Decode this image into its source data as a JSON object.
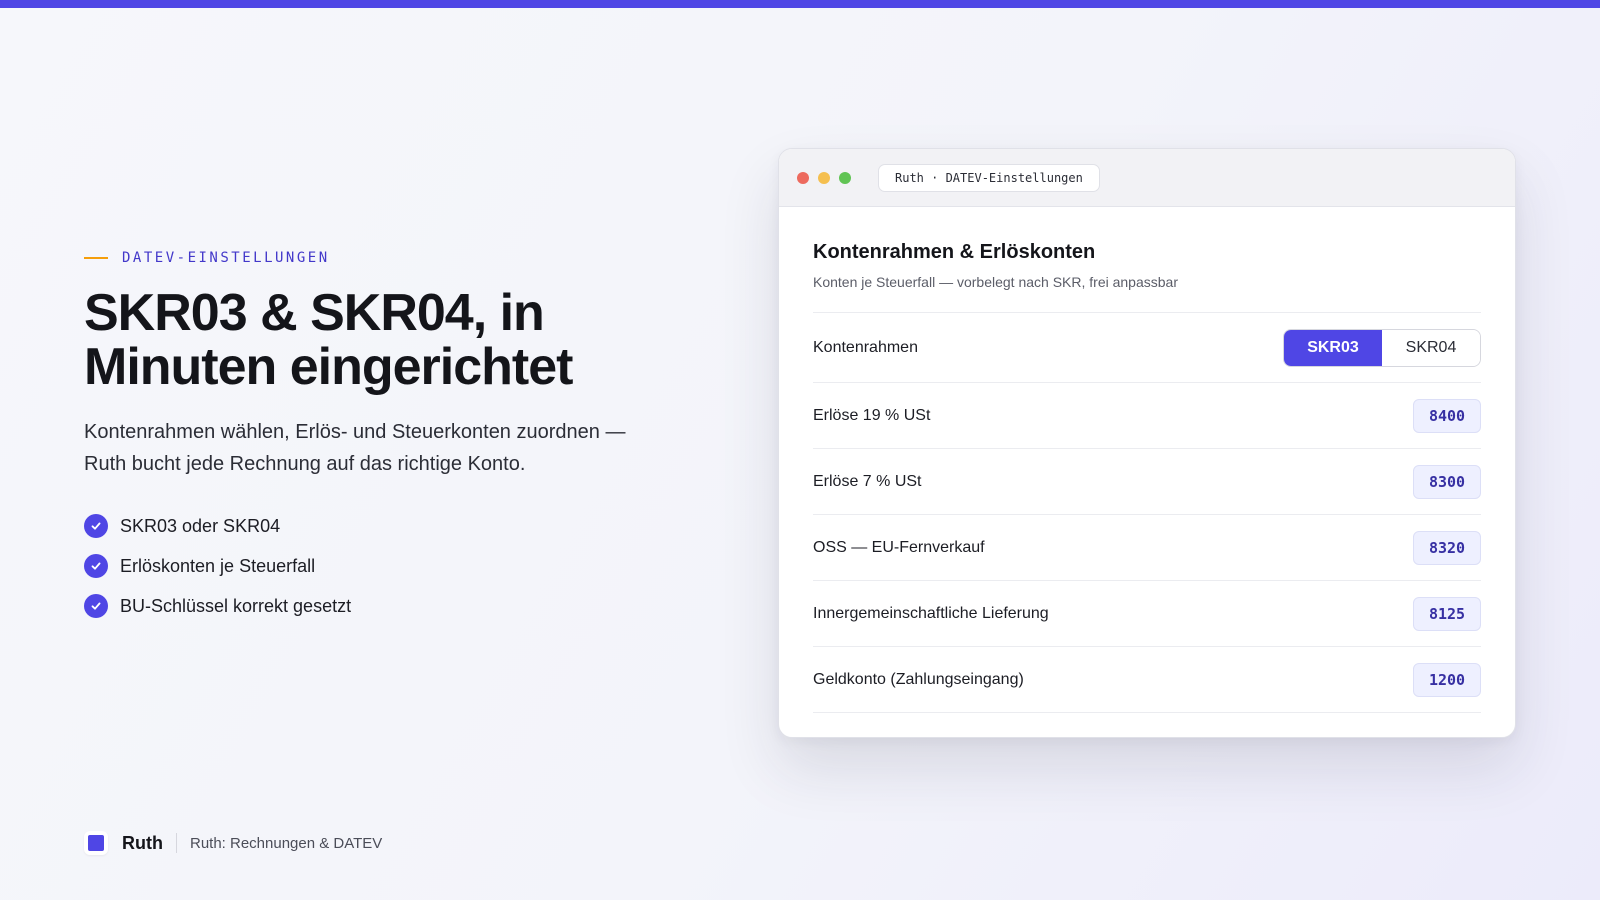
{
  "eyebrow": "DATEV-EINSTELLUNGEN",
  "headline": "SKR03 & SKR04, in Minuten eingerichtet",
  "lead": "Kontenrahmen wählen, Erlös- und Steuerkonten zuordnen — Ruth bucht jede Rechnung auf das richtige Konto.",
  "bullets": [
    {
      "icon": "check-circle-icon",
      "text": "SKR03 oder SKR04"
    },
    {
      "icon": "check-circle-icon",
      "text": "Erlöskonten je Steuerfall"
    },
    {
      "icon": "check-circle-icon",
      "text": "BU-Schlüssel korrekt gesetzt"
    }
  ],
  "footer": {
    "brand": "Ruth",
    "subtitle": "Ruth: Rechnungen & DATEV"
  },
  "window": {
    "tab_title": "Ruth · DATEV-Einstellungen",
    "title": "Kontenrahmen & Erlöskonten",
    "subtitle": "Konten je Steuerfall — vorbelegt nach SKR, frei anpassbar",
    "kontenrahmen": {
      "label": "Kontenrahmen",
      "options": [
        "SKR03",
        "SKR04"
      ],
      "selected": "SKR03"
    },
    "accounts": [
      {
        "label": "Erlöse 19 % USt",
        "code": "8400"
      },
      {
        "label": "Erlöse 7 % USt",
        "code": "8300"
      },
      {
        "label": "OSS — EU-Fernverkauf",
        "code": "8320"
      },
      {
        "label": "Innergemeinschaftliche Lieferung",
        "code": "8125"
      },
      {
        "label": "Geldkonto (Zahlungseingang)",
        "code": "1200"
      }
    ]
  },
  "colors": {
    "accent": "#4f46e5",
    "eyebrow_line": "#f59e0b",
    "code_text": "#3730a3",
    "code_bg": "#eef0ff"
  }
}
